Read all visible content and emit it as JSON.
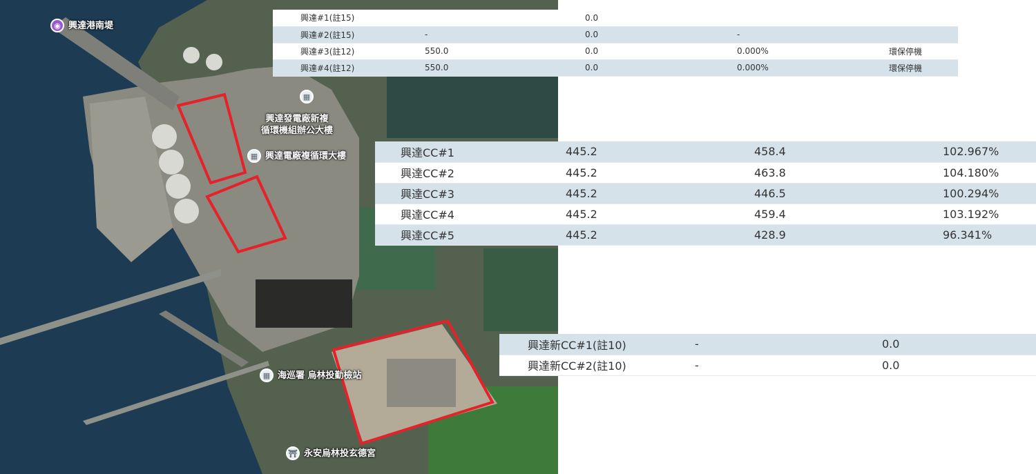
{
  "map": {
    "colors": {
      "sea": "#1d3b52",
      "land": "#8a8a80",
      "outline": "#e5222a",
      "green": "#2f5a3a"
    },
    "pois": [
      {
        "name": "興達港南堤",
        "icon": "camera-icon"
      },
      {
        "name": "興達發電廠",
        "icon": "building-icon"
      },
      {
        "name": "興達發電廠新複循環機組辦公大樓",
        "icon": "building-icon",
        "lines": [
          "興達發電廠新複",
          "循環機組辦公大樓"
        ]
      },
      {
        "name": "興達電廠複循環大樓",
        "icon": "building-icon"
      },
      {
        "name": "海巡署 烏林投勤檢站",
        "icon": "building-icon"
      },
      {
        "name": "永安烏林投玄德宮",
        "icon": "temple-icon"
      }
    ]
  },
  "table_top": {
    "rows": [
      {
        "unit": "興達#1(註15)",
        "capacity": "",
        "output": "0.0",
        "ratio": "",
        "note": ""
      },
      {
        "unit": "興達#2(註15)",
        "capacity": "-",
        "output": "0.0",
        "ratio": "-",
        "note": ""
      },
      {
        "unit": "興達#3(註12)",
        "capacity": "550.0",
        "output": "0.0",
        "ratio": "0.000%",
        "note": "環保停機"
      },
      {
        "unit": "興達#4(註12)",
        "capacity": "550.0",
        "output": "0.0",
        "ratio": "0.000%",
        "note": "環保停機"
      }
    ]
  },
  "table_cc": {
    "rows": [
      {
        "unit": "興達CC#1",
        "capacity": "445.2",
        "output": "458.4",
        "ratio": "102.967%"
      },
      {
        "unit": "興達CC#2",
        "capacity": "445.2",
        "output": "463.8",
        "ratio": "104.180%"
      },
      {
        "unit": "興達CC#3",
        "capacity": "445.2",
        "output": "446.5",
        "ratio": "100.294%"
      },
      {
        "unit": "興達CC#4",
        "capacity": "445.2",
        "output": "459.4",
        "ratio": "103.192%"
      },
      {
        "unit": "興達CC#5",
        "capacity": "445.2",
        "output": "428.9",
        "ratio": "96.341%"
      }
    ]
  },
  "table_new": {
    "rows": [
      {
        "unit": "興達新CC#1(註10)",
        "capacity": "-",
        "output": "0.0"
      },
      {
        "unit": "興達新CC#2(註10)",
        "capacity": "-",
        "output": "0.0"
      }
    ]
  }
}
